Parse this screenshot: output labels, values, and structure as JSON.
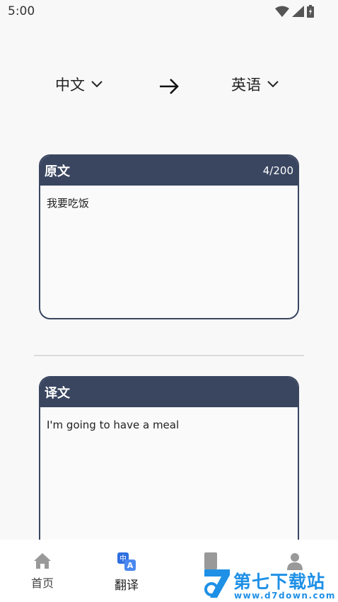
{
  "status_bar": {
    "time": "5:00",
    "icons": [
      "wifi-icon",
      "signal-icon",
      "battery-icon"
    ]
  },
  "languages": {
    "source": "中文",
    "target": "英语"
  },
  "source_card": {
    "title": "原文",
    "char_count": "4/200",
    "text": "我要吃饭"
  },
  "result_card": {
    "title": "译文",
    "text": "I'm going to have a meal"
  },
  "bottom_nav": {
    "items": [
      {
        "label": "首页",
        "icon": "home-icon"
      },
      {
        "label": "翻译",
        "icon": "translate-icon",
        "active": true
      },
      {
        "label": "",
        "icon": "book-icon"
      },
      {
        "label": "",
        "icon": "person-icon"
      }
    ]
  },
  "watermark": {
    "logo_text": "第七下载站",
    "url": "www.d7down.com"
  },
  "colors": {
    "header": "#3a4660",
    "background": "#f8f8f8",
    "watermark": "#1e90e6",
    "translate_icon": "#2f6fe0"
  }
}
